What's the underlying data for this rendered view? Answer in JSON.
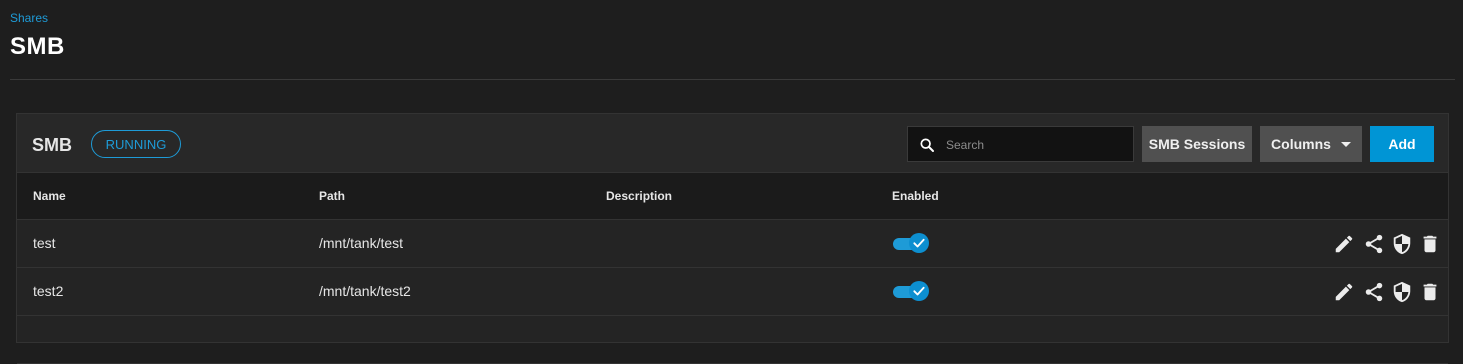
{
  "breadcrumb": "Shares",
  "page_title": "SMB",
  "card": {
    "title": "SMB",
    "status": "RUNNING",
    "search": {
      "placeholder": "Search",
      "value": ""
    },
    "buttons": {
      "sessions": "SMB Sessions",
      "columns": "Columns",
      "add": "Add"
    }
  },
  "table": {
    "columns": [
      "Name",
      "Path",
      "Description",
      "Enabled"
    ],
    "rows": [
      {
        "name": "test",
        "path": "/mnt/tank/test",
        "description": "",
        "enabled": true
      },
      {
        "name": "test2",
        "path": "/mnt/tank/test2",
        "description": "",
        "enabled": true
      }
    ]
  },
  "icons": [
    "search-icon",
    "pencil-icon",
    "share-icon",
    "shield-icon",
    "trash-icon",
    "check-icon",
    "chevron-down-icon"
  ],
  "colors": {
    "accent": "#1e9bd7",
    "add_button": "#0095d5",
    "background": "#1e1e1e"
  }
}
